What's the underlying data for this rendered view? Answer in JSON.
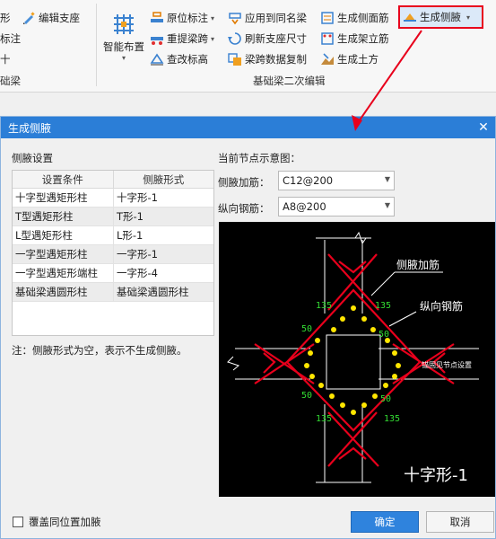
{
  "ribbon": {
    "left_items": [
      {
        "label": "形",
        "icon": "partial-icon"
      },
      {
        "label": "标注",
        "icon": "partial-icon"
      },
      {
        "label": "十",
        "icon": "partial-icon"
      }
    ],
    "left_group_label": "础梁",
    "col1": [
      {
        "label": "编辑支座",
        "icon": "edit-support-icon"
      }
    ],
    "big_button": {
      "label": "智能布置",
      "icon": "smart-layout-icon"
    },
    "col2": [
      {
        "label": "原位标注",
        "icon": "in-situ-annotation-icon"
      },
      {
        "label": "重提梁跨",
        "icon": "re-extract-span-icon"
      },
      {
        "label": "查改标高",
        "icon": "elevation-icon"
      }
    ],
    "col3": [
      {
        "label": "应用到同名梁",
        "icon": "apply-same-name-icon"
      },
      {
        "label": "刷新支座尺寸",
        "icon": "refresh-support-icon"
      },
      {
        "label": "梁跨数据复制",
        "icon": "span-copy-icon"
      }
    ],
    "col4": [
      {
        "label": "生成侧面筋",
        "icon": "side-rebar-icon"
      },
      {
        "label": "生成架立筋",
        "icon": "erection-rebar-icon"
      },
      {
        "label": "生成土方",
        "icon": "earthwork-icon"
      }
    ],
    "highlight": {
      "label": "生成侧腋",
      "icon": "haunch-icon"
    },
    "group_label": "基础梁二次编辑"
  },
  "dialog": {
    "title": "生成侧腋",
    "left_title": "侧腋设置",
    "table": {
      "headers": [
        "设置条件",
        "侧腋形式"
      ],
      "rows": [
        [
          "十字型遇矩形柱",
          "十字形-1"
        ],
        [
          "T型遇矩形柱",
          "T形-1"
        ],
        [
          "L型遇矩形柱",
          "L形-1"
        ],
        [
          "一字型遇矩形柱",
          "一字形-1"
        ],
        [
          "一字型遇矩形端柱",
          "一字形-4"
        ],
        [
          "基础梁遇圆形柱",
          "基础梁遇圆形柱"
        ]
      ]
    },
    "note": "注：侧腋形式为空，表示不生成侧腋。",
    "right_title": "当前节点示意图：",
    "haunch_rebar_label": "侧腋加筋：",
    "haunch_rebar_value": "C12@200",
    "long_rebar_label": "纵向钢筋：",
    "long_rebar_value": "A8@200",
    "diagram": {
      "callout1": "侧腋加筋",
      "callout2": "纵向钢筋",
      "anchor_note": "锚固见节点设置",
      "dim135": "135",
      "dim50": "50",
      "caption": "十字形-1"
    },
    "checkbox_label": "覆盖同位置加腋",
    "ok": "确定",
    "cancel": "取消",
    "colors": {
      "accent": "#2b7ed7",
      "highlight": "#e8001c",
      "rebar": "#e8001c",
      "bar_dot": "#ffe600",
      "dim_text": "#33dd33"
    }
  }
}
